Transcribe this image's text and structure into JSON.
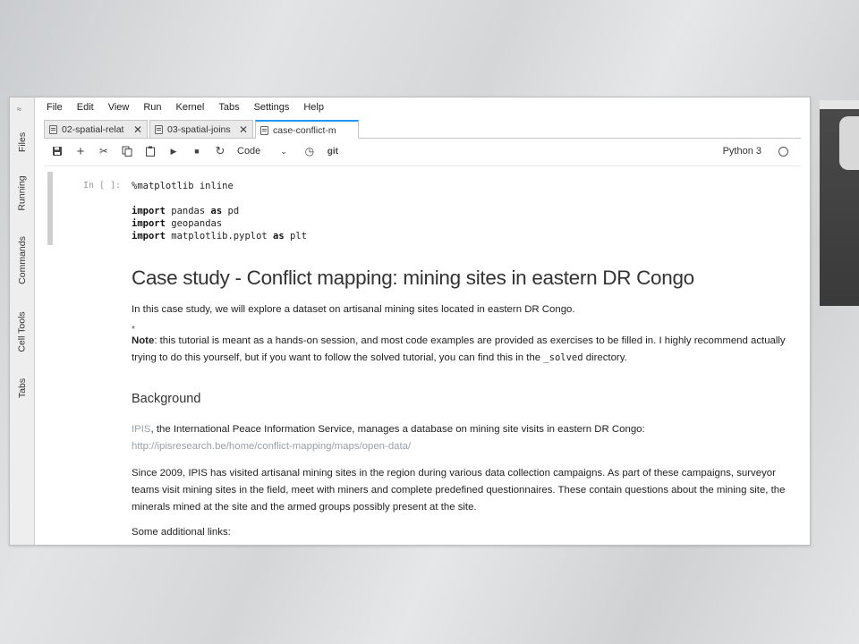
{
  "sidebar": {
    "tabs": [
      {
        "label": "Files"
      },
      {
        "label": "Running"
      },
      {
        "label": "Commands"
      },
      {
        "label": "Cell Tools"
      },
      {
        "label": "Tabs"
      }
    ]
  },
  "menubar": {
    "items": [
      "File",
      "Edit",
      "View",
      "Run",
      "Kernel",
      "Tabs",
      "Settings",
      "Help"
    ]
  },
  "tabs": [
    {
      "label": "02-spatial-relat"
    },
    {
      "label": "03-spatial-joins"
    },
    {
      "label": "case-conflict-m"
    }
  ],
  "toolbar": {
    "cell_type": "Code",
    "git_label": "git",
    "kernel": "Python 3"
  },
  "cells": {
    "code": {
      "prompt": "In [ ]:",
      "line1": "%matplotlib inline",
      "import1_kw": "import",
      "import1_rest": " pandas ",
      "import1_as": "as",
      "import1_alias": " pd",
      "import2_kw": "import",
      "import2_rest": " geopandas",
      "import3_kw": "import",
      "import3_rest": " matplotlib.pyplot ",
      "import3_as": "as",
      "import3_alias": " plt"
    },
    "markdown": {
      "title": "Case study - Conflict mapping: mining sites in eastern DR Congo",
      "intro": "In this case study, we will explore a dataset on artisanal mining sites located in eastern DR Congo.",
      "note_label": "Note",
      "note_text_1": ": this tutorial is meant as a hands-on session, and most code examples are provided as exercises to be filled in. I highly recommend actually trying to do this yourself, but if you want to follow the solved tutorial, you can find this in the ",
      "note_code": "_solved",
      "note_text_2": " directory.",
      "background_heading": "Background",
      "ipis_link": "IPIS",
      "ipis_text": ", the International Peace Information Service, manages a database on mining site visits in eastern DR Congo: ",
      "ipis_url": "http://ipisresearch.be/home/conflict-mapping/maps/open-data/",
      "since_text": "Since 2009, IPIS has visited artisanal mining sites in the region during various data collection campaigns. As part of these campaigns, surveyor teams visit mining sites in the field, meet with miners and complete predefined questionnaires. These contain questions about the mining site, the minerals mined at the site and the armed groups possibly present at the site.",
      "links_text": "Some additional links:"
    }
  }
}
